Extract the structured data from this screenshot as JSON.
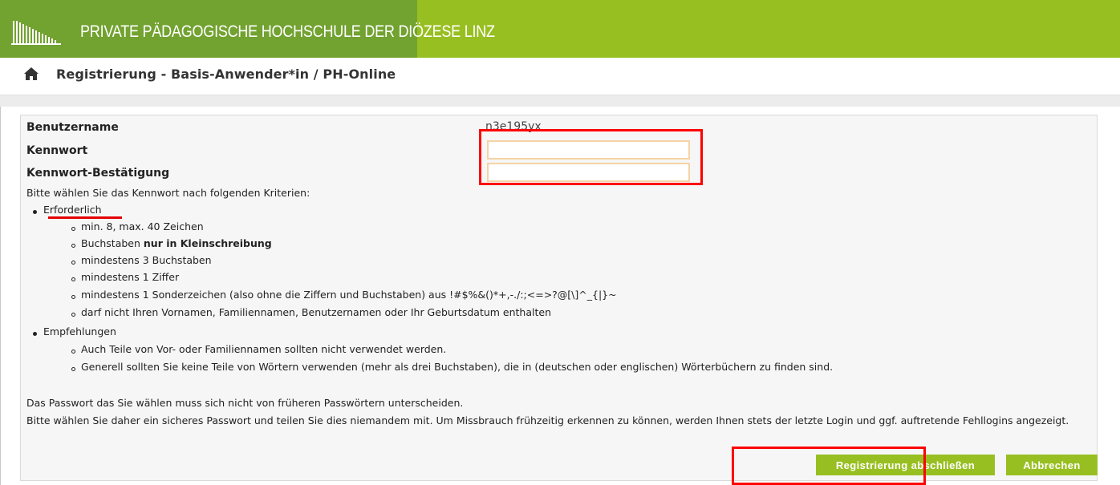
{
  "header": {
    "title": "PRIVATE PÄDAGOGISCHE HOCHSCHULE DER DIÖZESE LINZ",
    "colors": {
      "green": "#98bf21",
      "dark_green": "#72a230"
    }
  },
  "breadcrumb": {
    "icon": "home-icon",
    "text": "Registrierung - Basis-Anwender*in  / PH-Online"
  },
  "form": {
    "username_label": "Benutzername",
    "username_value": "n3e195yx",
    "password_label": "Kennwort",
    "password_value": "",
    "confirm_label": "Kennwort-Bestätigung",
    "confirm_value": ""
  },
  "criteria": {
    "intro": "Bitte wählen Sie das Kennwort nach folgenden Kriterien:",
    "required_label": "Erforderlich",
    "required_items": [
      "min. 8, max. 40 Zeichen",
      "Buchstaben ",
      "mindestens 3 Buchstaben",
      "mindestens 1 Ziffer",
      "mindestens 1 Sonderzeichen (also ohne die Ziffern und Buchstaben) aus !#$%&()*+,-./:;<=>?@[\\]^_{|}~",
      "darf nicht Ihren Vornamen, Familiennamen, Benutzernamen oder Ihr Geburtsdatum enthalten"
    ],
    "required_item_2_bold": "nur in Kleinschreibung",
    "recommend_label": "Empfehlungen",
    "recommend_items": [
      "Auch Teile von Vor- oder Familiennamen sollten nicht verwendet werden.",
      "Generell sollten Sie keine Teile von Wörtern verwenden (mehr als drei Buchstaben), die in (deutschen oder englischen) Wörterbüchern zu finden sind."
    ]
  },
  "notes": {
    "line1": "Das Passwort das Sie wählen muss sich nicht von früheren Passwörtern unterscheiden.",
    "line2": "Bitte wählen Sie daher ein sicheres Passwort und teilen Sie dies niemandem mit. Um Missbrauch frühzeitig erkennen zu können, werden Ihnen stets der letzte Login und ggf. auftretende Fehllogins angezeigt."
  },
  "buttons": {
    "register": "Registrierung abschließen",
    "cancel": "Abbrechen"
  }
}
